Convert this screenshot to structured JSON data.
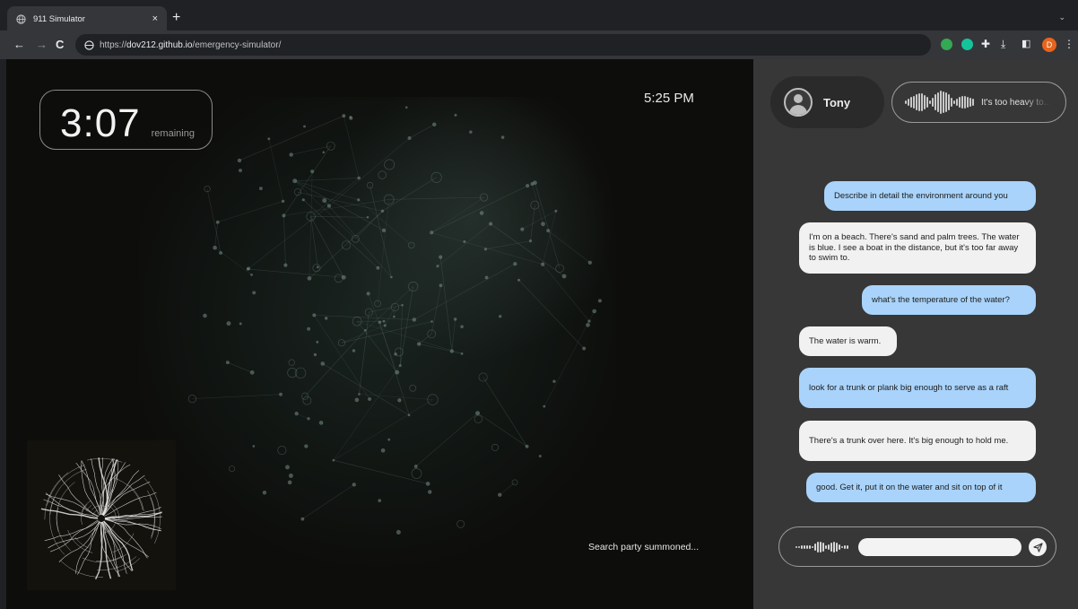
{
  "browser": {
    "tab_title": "911 Simulator",
    "tab_close": "×",
    "new_tab": "+",
    "tab_menu": "⌄",
    "back": "←",
    "forward": "→",
    "reload": "C",
    "url_scheme": "https://",
    "url_host": "dov212.github.io",
    "url_path": "/emergency-simulator/",
    "profile_initial": "D",
    "icons": [
      "globe-icon",
      "lock-icon",
      "extension-icon",
      "puzzle-icon",
      "download-icon",
      "side-panel-icon",
      "menu-icon"
    ]
  },
  "timer": {
    "value": "3:07",
    "label": "remaining"
  },
  "clock": "5:25 PM",
  "status": "Search party summoned...",
  "caller": {
    "name": "Tony"
  },
  "audio": {
    "caption": "It's too heavy to..."
  },
  "messages": [
    {
      "from": "operator",
      "text": "Describe in detail the environment around you"
    },
    {
      "from": "caller",
      "text": "I'm on a beach. There's sand and palm trees. The water is blue. I see a boat in the distance, but it's too far away to swim to."
    },
    {
      "from": "operator",
      "text": "what's the temperature of the water?"
    },
    {
      "from": "caller",
      "text": "The water is warm."
    },
    {
      "from": "operator",
      "text": "look for a trunk or plank big enough to serve as a raft"
    },
    {
      "from": "caller",
      "text": "There's a trunk over here. It's big enough to hold me."
    },
    {
      "from": "operator",
      "text": "good. Get it, put it on the water and sit on top of it"
    }
  ],
  "composer": {
    "value": "",
    "placeholder": ""
  },
  "colors": {
    "operator_bubble": "#a9d3fa",
    "caller_bubble": "#f1f1f1",
    "panel": "#373737",
    "stage": "#0d0d0b",
    "profile": "#e8641b"
  }
}
